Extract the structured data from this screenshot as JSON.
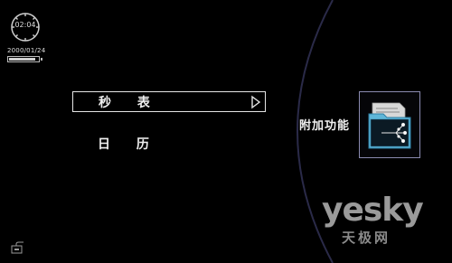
{
  "status": {
    "time": "02:04",
    "date": "2000/01/24",
    "battery_level": 0.9
  },
  "menu": {
    "items": [
      {
        "label": "秒 表",
        "selected": true
      },
      {
        "label": "日 历",
        "selected": false
      }
    ]
  },
  "feature": {
    "label": "附加功能",
    "icon": "folder-network-icon"
  },
  "watermark": {
    "brand": "yesky",
    "sub": "天极网"
  },
  "colors": {
    "background": "#000000",
    "text": "#f0f0f0",
    "tile_border": "#8a8ab0",
    "accent_icon": "#5fb6d8"
  }
}
